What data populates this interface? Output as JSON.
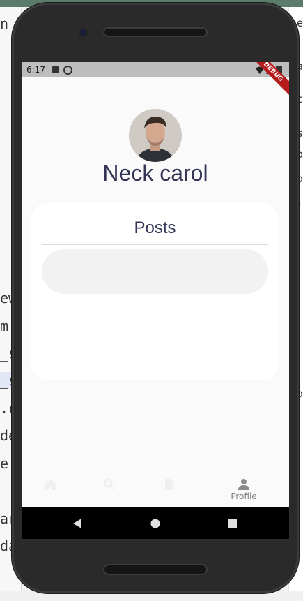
{
  "background": {
    "left_fragments": [
      "n",
      "ew",
      "m",
      "_s",
      "_s",
      ".c",
      "de",
      "e.c",
      "ar",
      "da"
    ],
    "right_fragments": [
      "ne",
      "a",
      "c",
      "s",
      "o",
      "o",
      "'",
      "o"
    ]
  },
  "status_bar": {
    "time": "6:17",
    "debug_banner": "DEBUG"
  },
  "profile": {
    "name": "Neck carol"
  },
  "posts_card": {
    "title": "Posts"
  },
  "bottom_nav": {
    "items": [
      {
        "icon": "home-icon",
        "label": ""
      },
      {
        "icon": "search-icon",
        "label": ""
      },
      {
        "icon": "document-icon",
        "label": ""
      },
      {
        "icon": "person-icon",
        "label": "Profile"
      }
    ]
  },
  "android_nav": {
    "buttons": [
      "back-icon",
      "home-circle-icon",
      "recents-icon"
    ]
  }
}
